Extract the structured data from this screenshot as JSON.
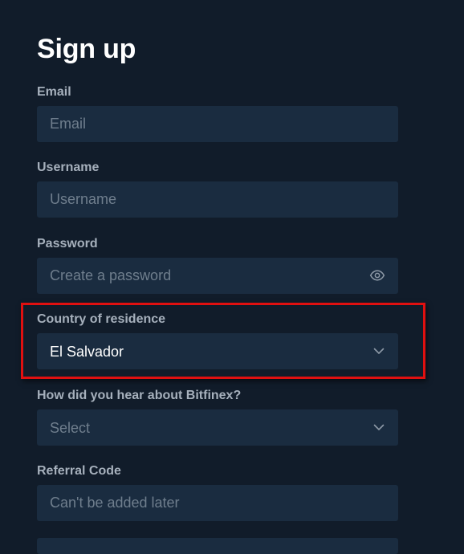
{
  "page": {
    "title": "Sign up"
  },
  "form": {
    "email": {
      "label": "Email",
      "placeholder": "Email",
      "value": ""
    },
    "username": {
      "label": "Username",
      "placeholder": "Username",
      "value": ""
    },
    "password": {
      "label": "Password",
      "placeholder": "Create a password",
      "value": "",
      "toggle_icon": "eye-icon"
    },
    "country": {
      "label": "Country of residence",
      "selected": "El Salvador",
      "icon": "chevron-down-icon"
    },
    "heard_about": {
      "label": "How did you hear about Bitfinex?",
      "placeholder": "Select",
      "icon": "chevron-down-icon"
    },
    "referral": {
      "label": "Referral Code",
      "placeholder": "Can't be added later",
      "value": ""
    }
  },
  "colors": {
    "background": "#111c2a",
    "field_background": "#1a2c40",
    "label": "#a6b0bc",
    "placeholder": "#6f7e8d",
    "highlight": "#e01010"
  }
}
